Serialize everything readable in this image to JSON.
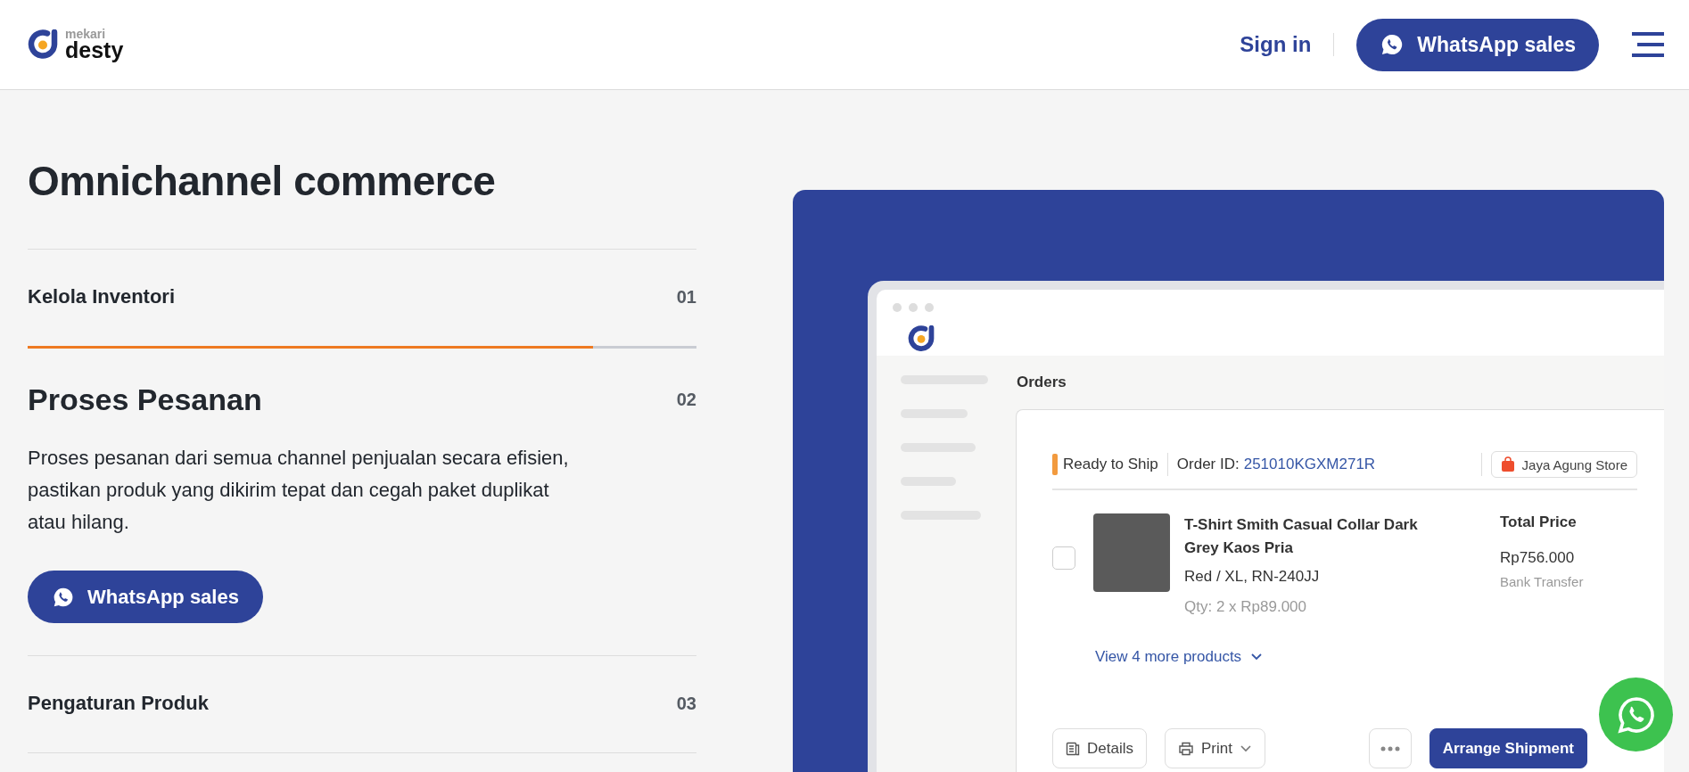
{
  "header": {
    "logo_top": "mekari",
    "logo_bottom": "desty",
    "sign_in": "Sign in",
    "cta": "WhatsApp sales"
  },
  "section": {
    "title": "Omnichannel commerce",
    "features": [
      {
        "title": "Kelola Inventori",
        "number": "01",
        "expanded": false
      },
      {
        "title": "Proses Pesanan",
        "number": "02",
        "expanded": true,
        "level": 0.845,
        "description": "Proses pesanan dari semua channel penjualan secara efisien, pastikan produk yang dikirim tepat dan cegah paket duplikat atau hilang.",
        "cta": "WhatsApp sales"
      },
      {
        "title": "Pengaturan Produk",
        "number": "03",
        "expanded": false
      }
    ]
  },
  "preview": {
    "page_title": "Orders",
    "order": {
      "status": "Ready to Ship",
      "order_id_label": "Order ID:",
      "order_id": "251010KGXM271R",
      "store": "Jaya Agung Store",
      "product": {
        "checked": false,
        "name": "T-Shirt Smith Casual Collar Dark Grey Kaos Pria",
        "variant": "Red / XL, RN-240JJ",
        "qty": "Qty: 2 x Rp89.000"
      },
      "total_label": "Total Price",
      "total": "Rp756.000",
      "payment": "Bank Transfer",
      "more_link": "View 4 more products",
      "actions": [
        {
          "kind": "details",
          "label": "Details"
        },
        {
          "kind": "print",
          "label": "Print"
        },
        {
          "kind": "more"
        },
        {
          "kind": "primary",
          "label": "Arrange Shipment"
        }
      ]
    }
  }
}
